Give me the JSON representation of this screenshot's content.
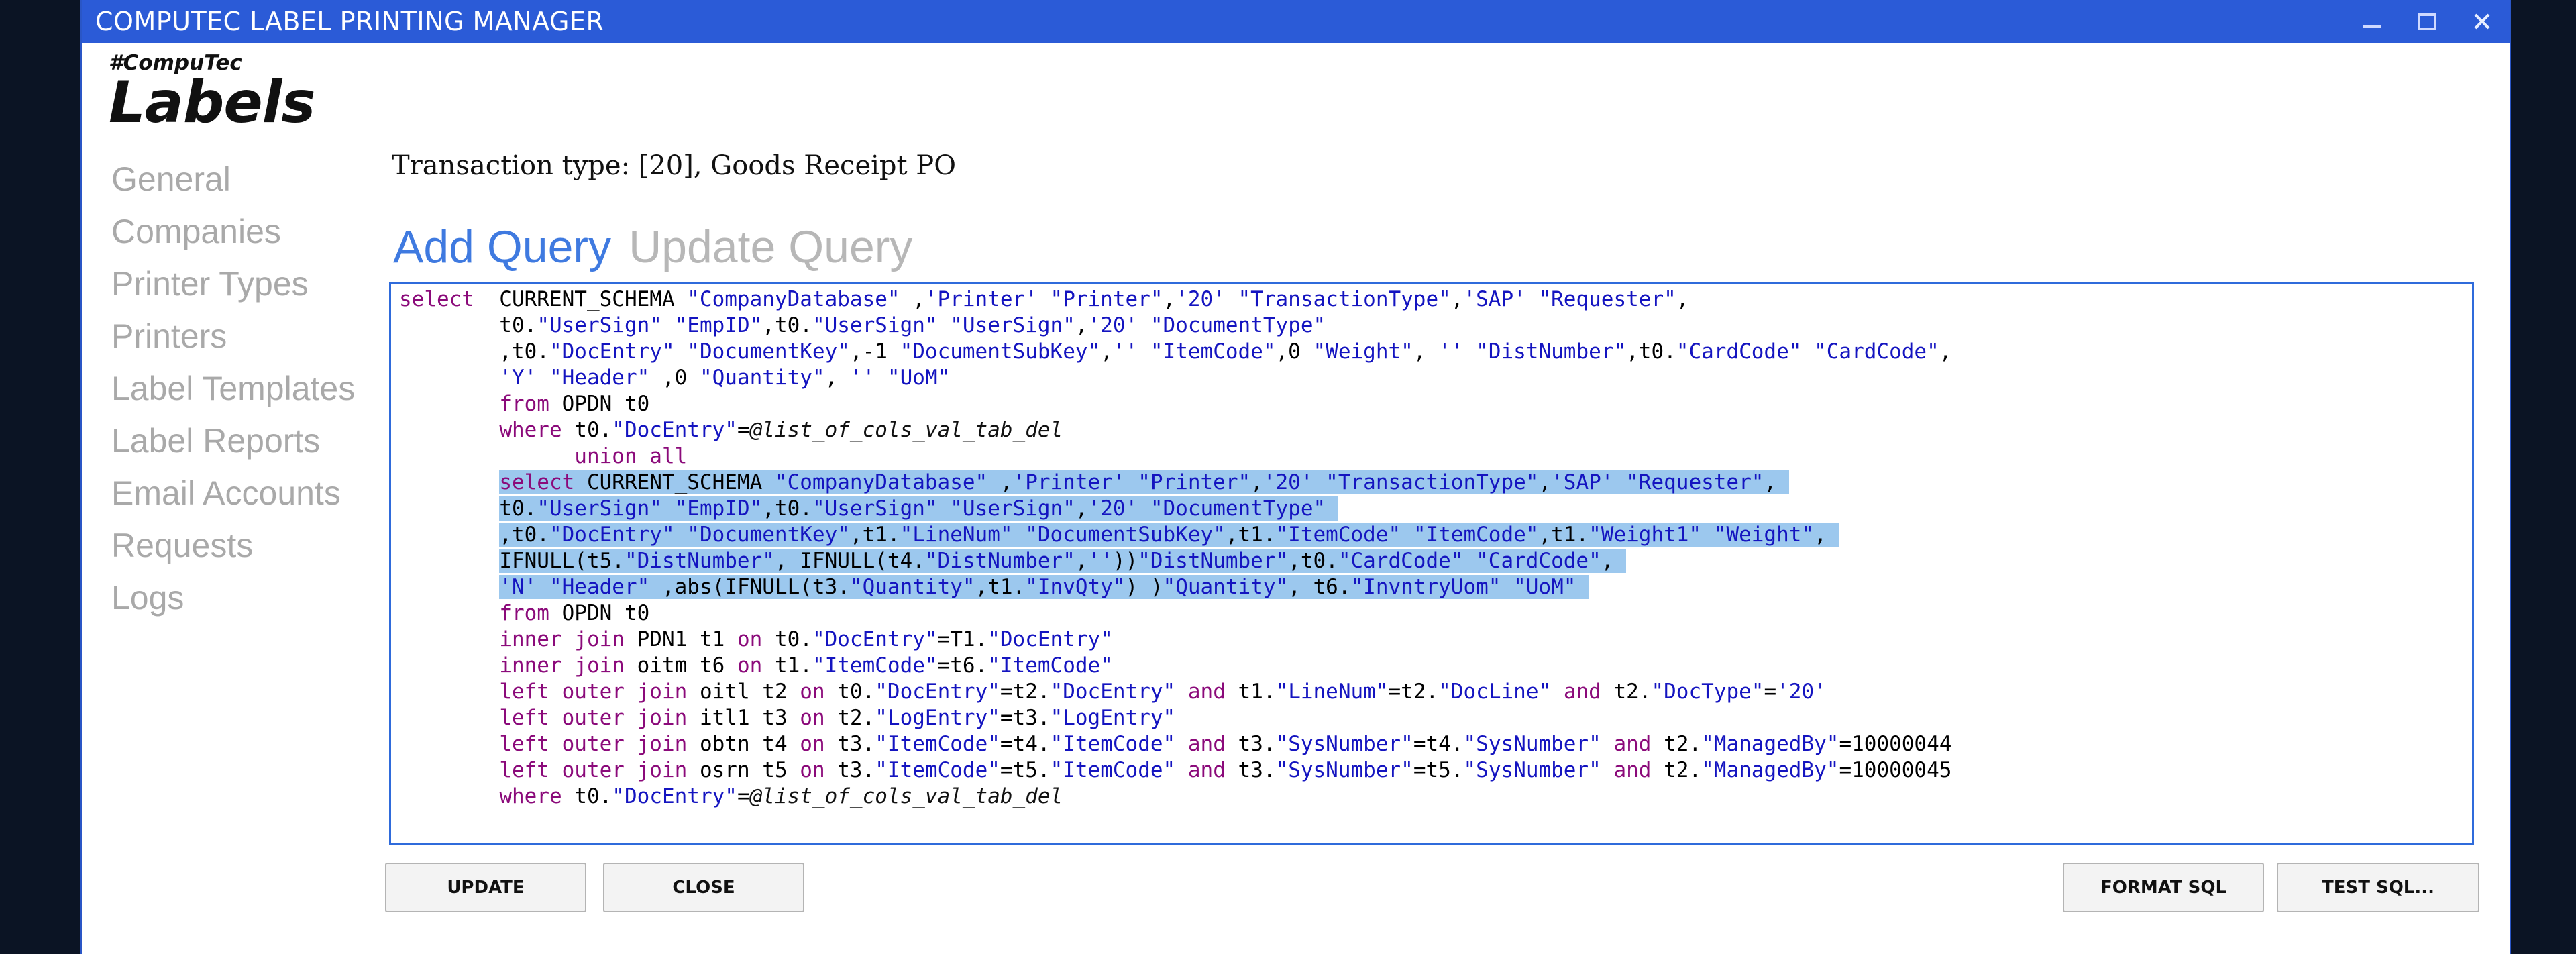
{
  "window": {
    "title": "COMPUTEC LABEL PRINTING MANAGER"
  },
  "logo": {
    "small": "#CompuTec",
    "big": "Labels"
  },
  "nav": [
    {
      "label": "General"
    },
    {
      "label": "Companies"
    },
    {
      "label": "Printer Types"
    },
    {
      "label": "Printers"
    },
    {
      "label": "Label Templates"
    },
    {
      "label": "Label Reports"
    },
    {
      "label": "Email Accounts"
    },
    {
      "label": "Requests"
    },
    {
      "label": "Logs"
    }
  ],
  "transaction_header": "Transaction type: [20], Goods Receipt PO",
  "tabs": {
    "add": "Add Query",
    "update": "Update Query",
    "active": "add"
  },
  "sql": {
    "lines": [
      "select  CURRENT_SCHEMA \"CompanyDatabase\" ,'Printer' \"Printer\",'20' \"TransactionType\",'SAP' \"Requester\",",
      "        t0.\"UserSign\" \"EmpID\",t0.\"UserSign\" \"UserSign\",'20' \"DocumentType\"",
      "        ,t0.\"DocEntry\" \"DocumentKey\",-1 \"DocumentSubKey\",'' \"ItemCode\",0 \"Weight\", '' \"DistNumber\",t0.\"CardCode\" \"CardCode\",",
      "        'Y' \"Header\" ,0 \"Quantity\", '' \"UoM\"",
      "        from OPDN t0",
      "        where t0.\"DocEntry\"=@list_of_cols_val_tab_del",
      "              union all",
      "        select CURRENT_SCHEMA \"CompanyDatabase\" ,'Printer' \"Printer\",'20' \"TransactionType\",'SAP' \"Requester\",",
      "        t0.\"UserSign\" \"EmpID\",t0.\"UserSign\" \"UserSign\",'20' \"DocumentType\"",
      "        ,t0.\"DocEntry\" \"DocumentKey\",t1.\"LineNum\" \"DocumentSubKey\",t1.\"ItemCode\" \"ItemCode\",t1.\"Weight1\" \"Weight\",",
      "        IFNULL(t5.\"DistNumber\", IFNULL(t4.\"DistNumber\",''))\"DistNumber\",t0.\"CardCode\" \"CardCode\",",
      "        'N' \"Header\" ,abs(IFNULL(t3.\"Quantity\",t1.\"InvQty\") )\"Quantity\", t6.\"InvntryUom\" \"UoM\"",
      "        from OPDN t0",
      "        inner join PDN1 t1 on t0.\"DocEntry\"=T1.\"DocEntry\"",
      "        inner join oitm t6 on t1.\"ItemCode\"=t6.\"ItemCode\"",
      "        left outer join oitl t2 on t0.\"DocEntry\"=t2.\"DocEntry\" and t1.\"LineNum\"=t2.\"DocLine\" and t2.\"DocType\"='20'",
      "        left outer join itl1 t3 on t2.\"LogEntry\"=t3.\"LogEntry\"",
      "        left outer join obtn t4 on t3.\"ItemCode\"=t4.\"ItemCode\" and t3.\"SysNumber\"=t4.\"SysNumber\" and t2.\"ManagedBy\"=10000044",
      "        left outer join osrn t5 on t3.\"ItemCode\"=t5.\"ItemCode\" and t3.\"SysNumber\"=t5.\"SysNumber\" and t2.\"ManagedBy\"=10000045",
      "        where t0.\"DocEntry\"=@list_of_cols_val_tab_del"
    ],
    "selected_lines": [
      7,
      8,
      9,
      10,
      11
    ]
  },
  "buttons": {
    "update": "UPDATE",
    "close": "CLOSE",
    "format": "FORMAT SQL",
    "test": "TEST SQL..."
  },
  "colors": {
    "titlebar": "#2b5bd7",
    "accent": "#3f7ae0",
    "selection": "#9cc8ee",
    "keyword": "#8b0a7a",
    "string": "#1414c0"
  }
}
